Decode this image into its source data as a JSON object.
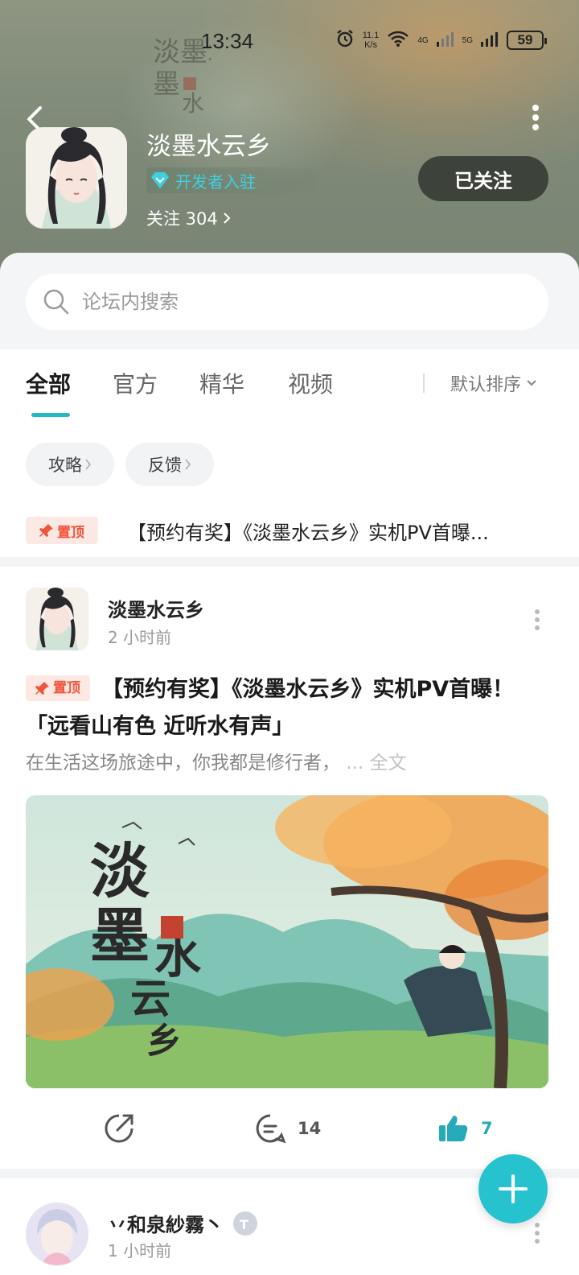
{
  "status_bar": {
    "time": "13:34",
    "net_speed_value": "11.1",
    "net_speed_unit": "K/s",
    "signal_1": "4G",
    "signal_2": "5G",
    "battery": "59"
  },
  "header": {
    "calligraphy": "淡墨水",
    "name": "淡墨水云乡",
    "badge": "开发者入驻",
    "follow_label": "关注 304",
    "followed_button": "已关注",
    "accent_color": "#3fd0e0"
  },
  "search": {
    "placeholder": "论坛内搜索"
  },
  "tabs": [
    {
      "label": "全部",
      "active": true
    },
    {
      "label": "官方",
      "active": false
    },
    {
      "label": "精华",
      "active": false
    },
    {
      "label": "视频",
      "active": false
    }
  ],
  "sort": {
    "label": "默认排序"
  },
  "chips": [
    "攻略",
    "反馈"
  ],
  "pinned": {
    "tag": "置顶",
    "text": "【预约有奖】《淡墨水云乡》实机PV首曝..."
  },
  "post": {
    "author": "淡墨水云乡",
    "time": "2 小时前",
    "tag": "置顶",
    "title": "【预约有奖】《淡墨水云乡》实机PV首曝！「远看山有色 近听水有声」",
    "excerpt": "在生活这场旅途中，你我都是修行者，",
    "excerpt_more": "... 全文",
    "image_calligraphy": "淡墨水云乡",
    "comments": "14",
    "likes": "7"
  },
  "next_post": {
    "author": "丷和泉紗霧丶",
    "time": "1 小时前"
  },
  "colors": {
    "brand_teal": "#26c3cf",
    "pin_red": "#f0553b"
  }
}
